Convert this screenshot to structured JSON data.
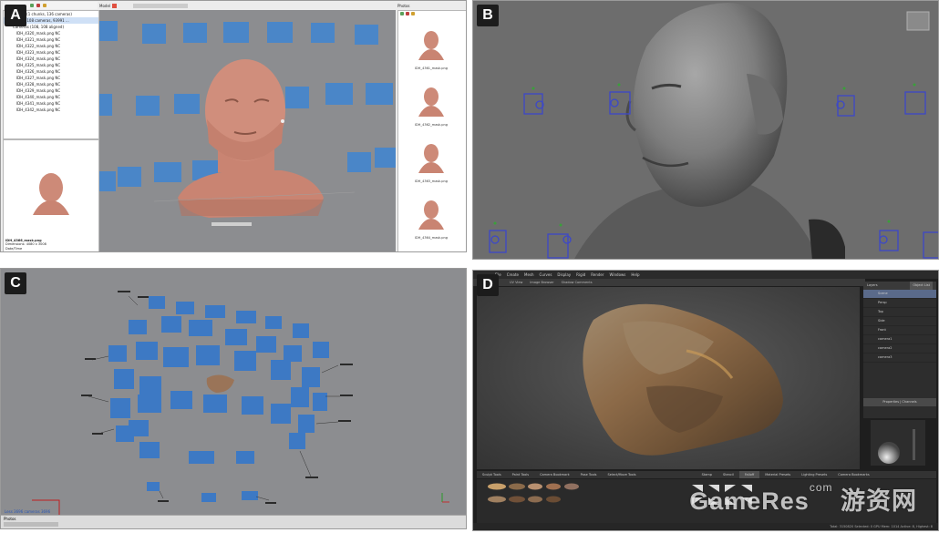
{
  "panels": {
    "a": {
      "label": "A"
    },
    "b": {
      "label": "B"
    },
    "c": {
      "label": "C"
    },
    "d": {
      "label": "D"
    }
  },
  "panel_a": {
    "workspace_line": "Workspace (1 chunks, 136 cameras)",
    "chunk_line": "Chunk 1 (108 cameras, 93991 ...",
    "cameras_line": "Cameras (108, 108 aligned)",
    "camera_items": [
      "IDH_4320_mask.png NC",
      "IDH_4321_mask.png NC",
      "IDH_4322_mask.png NC",
      "IDH_4323_mask.png NC",
      "IDH_4324_mask.png NC",
      "IDH_4325_mask.png NC",
      "IDH_4326_mask.png NC",
      "IDH_4327_mask.png NC",
      "IDH_4328_mask.png NC",
      "IDH_4329_mask.png NC",
      "IDH_4340_mask.png NC",
      "IDH_4341_mask.png NC",
      "IDH_4342_mask.png NC"
    ],
    "model_tab": "Model",
    "photos_title": "Photos",
    "photo_items": [
      "IDH_4361_mask.png",
      "IDH_4362_mask.png",
      "IDH_4363_mask.png",
      "IDH_4364_mask.png"
    ],
    "thumb_caption_1": "IDH_4366_mask.png",
    "thumb_caption_2": "Dimensions: 4080 x 3008",
    "thumb_caption_3": "Date/Time"
  },
  "panel_c": {
    "status_text": "Less 3696 cameras 3696",
    "toolbar_label": "Photos"
  },
  "panel_d": {
    "menu": [
      "File",
      "Create",
      "Mesh",
      "Curves",
      "Display",
      "Rigid",
      "Render",
      "Windows",
      "Help"
    ],
    "subtabs": [
      "UV View",
      "Image Browser",
      "Shadow Comments"
    ],
    "layers_title": "Layers",
    "layers_button": "Object List",
    "layer_rows": [
      "Scene",
      "Persp",
      "Top",
      "Side",
      "Front",
      "camera1",
      "camera2",
      "camera3"
    ],
    "layers_bottom": "Properties | Channels",
    "tools": [
      "Sculpt Tools",
      "Paint Tools",
      "Camera Bookmark",
      "Pose Tools",
      "Select/Move Tools",
      "Stamp",
      "Stencil",
      "Falloff",
      "Material Presets",
      "Lighting Presets",
      "Camera Bookmarks"
    ],
    "active_tool": "Falloff",
    "status": "Total: 3150820  Selected: 0  GPU Mem: 1014  Active: 8, Highest: 8"
  },
  "watermark": {
    "main": "GameRes",
    "sub": "com",
    "cn": "游资网"
  },
  "colors": {
    "camera_blue": "#4a86c8",
    "bust_skin": "#cd8a78",
    "viewport_grey": "#8c8d90",
    "maya_grey": "#6d6d6d",
    "dark_ui": "#1e1e1e"
  }
}
